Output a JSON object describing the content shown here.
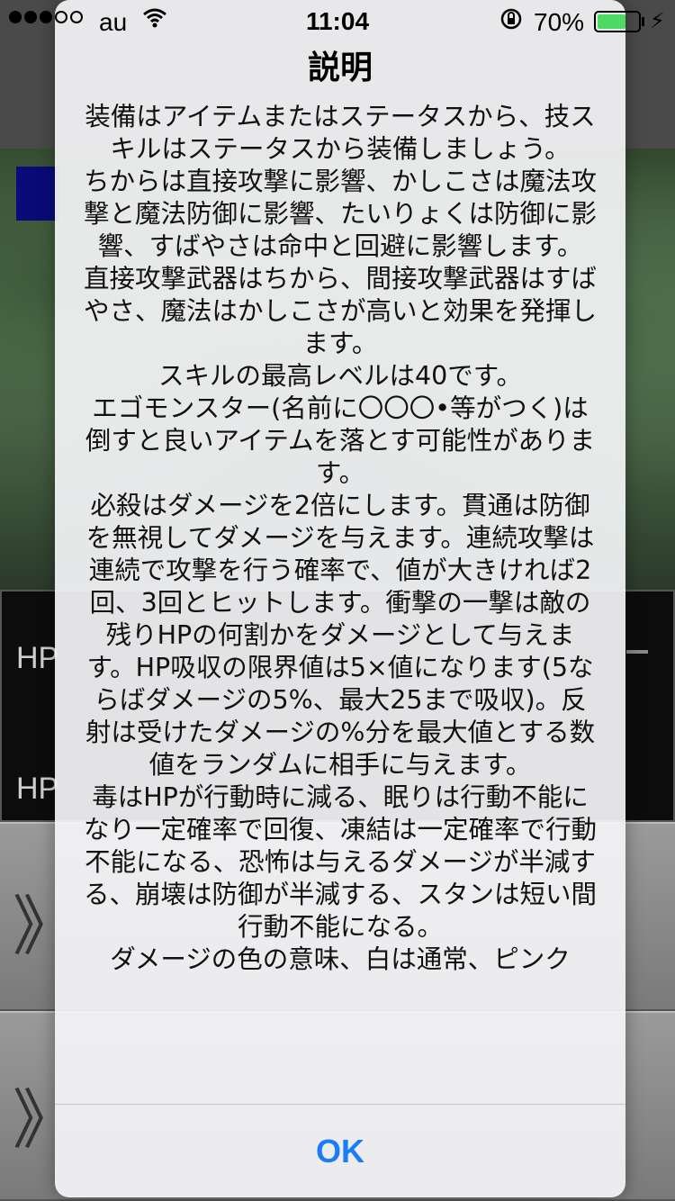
{
  "status_bar": {
    "carrier": "au",
    "time": "11:04",
    "battery_percent": "70%",
    "battery_level": 0.7,
    "signal_dots_filled": 3,
    "signal_dots_total": 5
  },
  "background": {
    "hp_label_1": "HP",
    "hp_label_2": "HP",
    "row_chevron": "》"
  },
  "alert": {
    "title": "説明",
    "paragraphs": [
      "装備はアイテムまたはステータスから、技スキルはステータスから装備しましょう。",
      "ちからは直接攻撃に影響、かしこさは魔法攻撃と魔法防御に影響、たいりょくは防御に影響、すばやさは命中と回避に影響します。",
      "直接攻撃武器はちから、間接攻撃武器はすばやさ、魔法はかしこさが高いと効果を発揮します。",
      "スキルの最高レベルは40です。",
      "エゴモンスター(名前に〇〇〇•等がつく)は倒すと良いアイテムを落とす可能性があります。",
      "必殺はダメージを2倍にします。貫通は防御を無視してダメージを与えます。連続攻撃は連続で攻撃を行う確率で、値が大きければ2回、3回とヒットします。衝撃の一撃は敵の残りHPの何割かをダメージとして与えます。HP吸収の限界値は5×値になります(5ならばダメージの5%、最大25まで吸収)。反射は受けたダメージの%分を最大値とする数値をランダムに相手に与えます。",
      "毒はHPが行動時に減る、眠りは行動不能になり一定確率で回復、凍結は一定確率で行動不能になる、恐怖は与えるダメージが半減する、崩壊は防御が半減する、スタンは短い間行動不能になる。",
      "ダメージの色の意味、白は通常、ピンク"
    ],
    "ok_label": "OK"
  },
  "colors": {
    "accent": "#1a7cf6",
    "battery_fill": "#4cd964",
    "blue_button": "#0a0a78"
  }
}
